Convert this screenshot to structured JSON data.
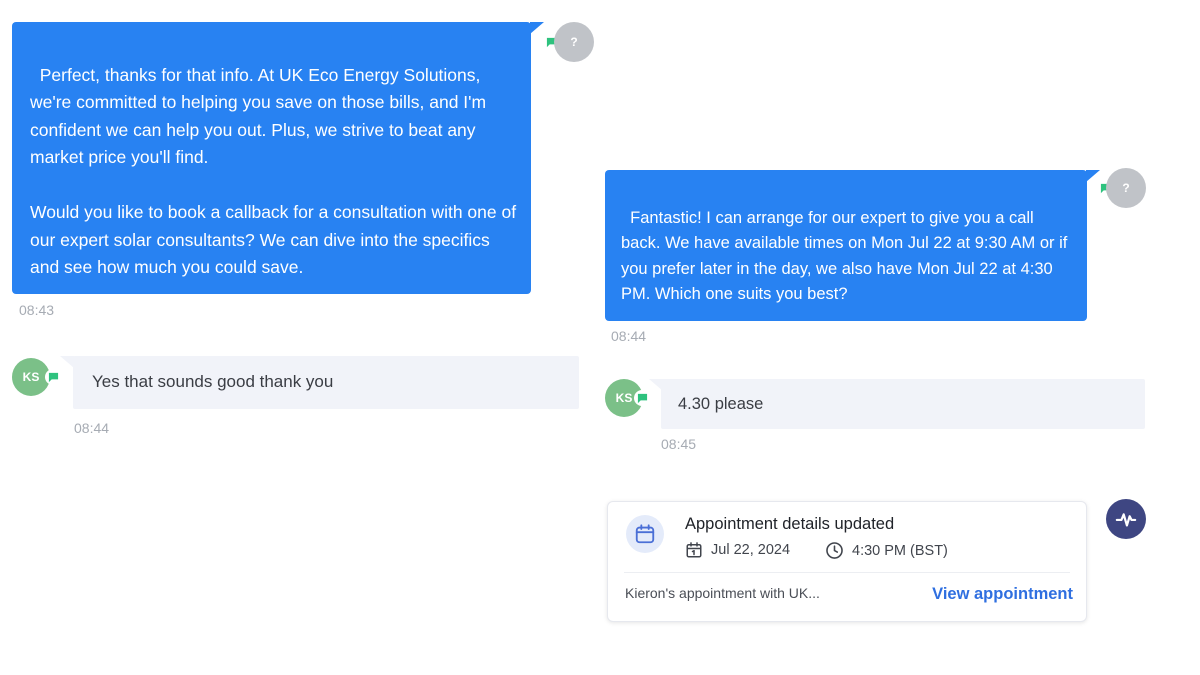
{
  "conversation": {
    "msg1": {
      "text": "Perfect, thanks for that info. At UK Eco Energy Solutions, we're committed to helping you save on those bills, and I'm confident we can help you out. Plus, we strive to beat any market price you'll find.\n\nWould you like to book a callback for a consultation with one of our expert solar consultants? We can dive into the specifics and see how much you could save.",
      "time": "08:43",
      "avatar_text": "?"
    },
    "msg2": {
      "text": "Yes that sounds good thank you",
      "time": "08:44",
      "avatar_text": "KS"
    },
    "msg3": {
      "text": "Fantastic! I can arrange for our expert to give you a call back. We have available times on Mon Jul 22 at 9:30 AM or if you prefer later in the day, we also have Mon Jul 22 at 4:30 PM. Which one suits you best?",
      "time": "08:44",
      "avatar_text": "?"
    },
    "msg4": {
      "text": "4.30 please",
      "time": "08:45",
      "avatar_text": "KS"
    }
  },
  "appointment_card": {
    "title": "Appointment details updated",
    "date": "Jul 22, 2024",
    "time": "4:30 PM (BST)",
    "description": "Kieron's appointment with UK...",
    "link_label": "View appointment"
  },
  "icons": {
    "channel": "chat-bubble-icon",
    "calendar": "calendar-icon",
    "clock": "clock-icon",
    "activity": "activity-pulse-icon"
  },
  "colors": {
    "agent_bubble": "#2882f2",
    "customer_bubble": "#f1f3f9",
    "customer_avatar": "#7bc088",
    "channel_badge": "#2ec27e",
    "link": "#2f6fe0",
    "activity_avatar": "#3e4682"
  }
}
